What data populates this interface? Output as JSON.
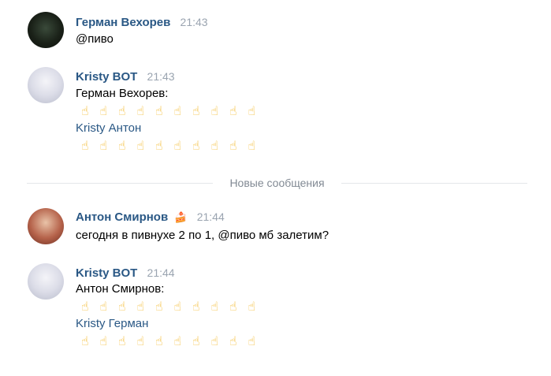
{
  "messages": [
    {
      "author": "Герман Вехорев",
      "time": "21:43",
      "lines": [
        "@пиво"
      ]
    },
    {
      "author": "Kristy BOT",
      "time": "21:43",
      "lines": [
        "Герман Вехорев:",
        "Kristy Антон"
      ],
      "finger_count": 10
    },
    {
      "author": "Антон Смирнов",
      "author_emoji": "🍰",
      "time": "21:44",
      "lines": [
        "сегодня в пивнухе 2 по 1, @пиво мб залетим?"
      ]
    },
    {
      "author": "Kristy BOT",
      "time": "21:44",
      "lines": [
        "Антон Смирнов:",
        "Kristy Герман"
      ],
      "finger_count": 10
    }
  ],
  "divider": {
    "label": "Новые сообщения"
  },
  "icons": {
    "finger": "☝"
  },
  "colors": {
    "author": "#2a5885",
    "time": "#9aa4b0",
    "finger": "#f2b51f"
  }
}
